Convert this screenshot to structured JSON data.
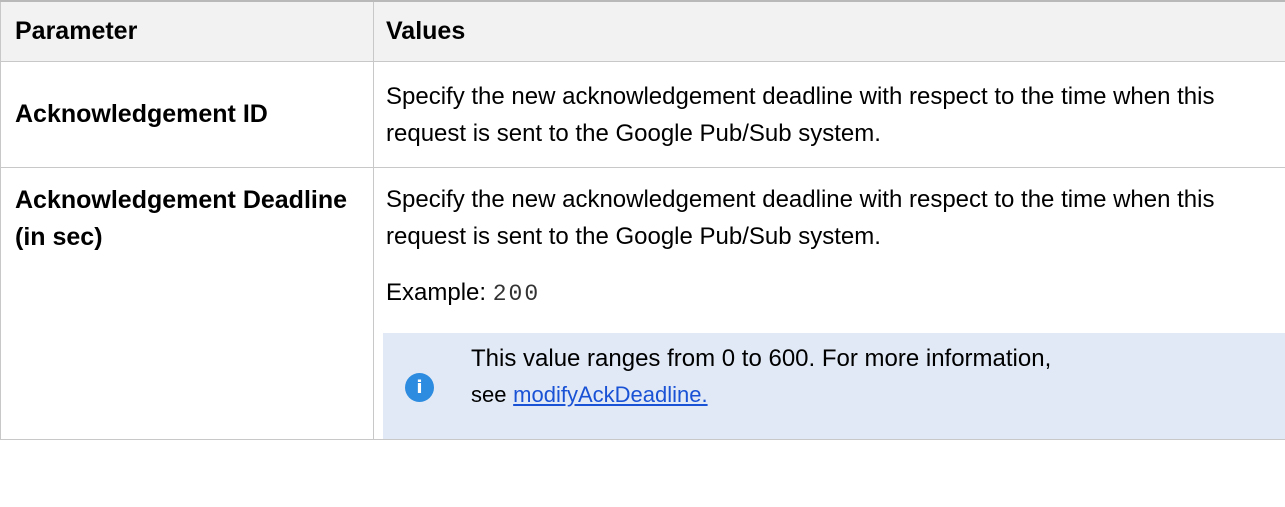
{
  "table": {
    "headers": {
      "parameter": "Parameter",
      "values": "Values"
    },
    "rows": [
      {
        "name": "Acknowledgement ID",
        "description": "Specify the new acknowledgement deadline with respect to the time when this request is sent to the Google Pub/Sub system."
      },
      {
        "name": "Acknowledgement Deadline (in sec)",
        "description": "Specify the new acknowledgement deadline with respect to the time when this request is sent to the Google Pub/Sub system.",
        "example_label": "Example:",
        "example_value": "200",
        "note": {
          "icon": "info-icon",
          "text": "This value ranges from 0 to 600. For more information,",
          "see_label": "see",
          "link_text": "modifyAckDeadline."
        }
      }
    ]
  },
  "colors": {
    "header_background": "#f2f2f2",
    "border": "#c8c8c8",
    "note_background": "#e0e9f5",
    "info_icon": "#2d8be0",
    "link": "#1a52d6"
  }
}
